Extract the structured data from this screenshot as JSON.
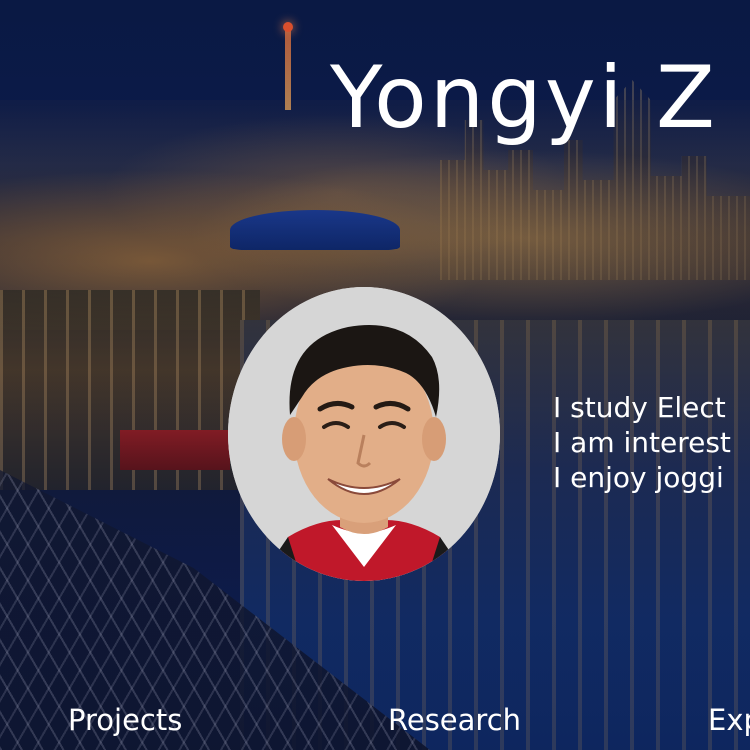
{
  "header": {
    "name": "Yongyi Z"
  },
  "bio": {
    "lines": [
      "I study Elect",
      "I am interest",
      "I enjoy joggi"
    ]
  },
  "nav": {
    "items": [
      {
        "label": "Projects"
      },
      {
        "label": "Research"
      },
      {
        "label": "Exp"
      }
    ]
  }
}
